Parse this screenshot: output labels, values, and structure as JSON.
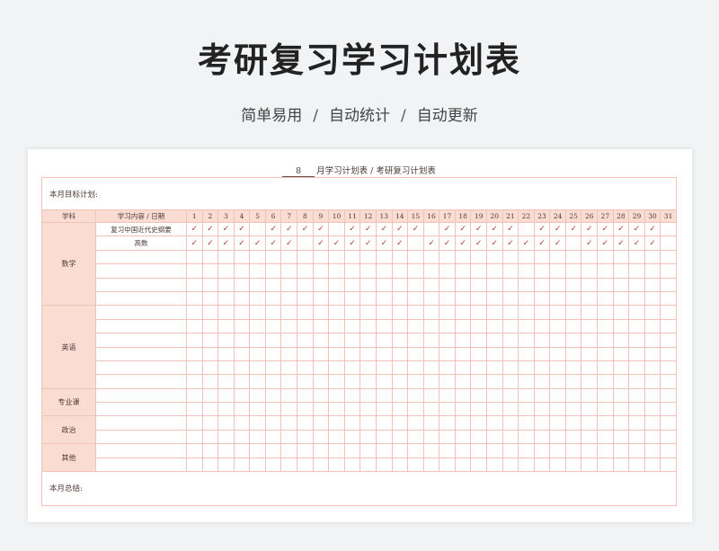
{
  "header": {
    "title": "考研复习学习计划表",
    "features": [
      "简单易用",
      "自动统计",
      "自动更新"
    ],
    "separator": "/"
  },
  "sheet": {
    "month": "8",
    "heading": "月学习计划表 / 考研复习计划表",
    "goal_label": "本月目标计划:",
    "summary_label": "本月总结:",
    "check_mark": "✓",
    "columns": {
      "subject": "学科",
      "content": "学习内容 / 日期",
      "days": [
        "1",
        "2",
        "3",
        "4",
        "5",
        "6",
        "7",
        "8",
        "9",
        "10",
        "11",
        "12",
        "13",
        "14",
        "15",
        "16",
        "17",
        "18",
        "19",
        "20",
        "21",
        "22",
        "23",
        "24",
        "25",
        "26",
        "27",
        "28",
        "29",
        "30",
        "31"
      ]
    },
    "subjects": [
      {
        "name": "数学",
        "rows": [
          {
            "content": "复习中国近代史纲要",
            "checked": [
              1,
              2,
              3,
              4,
              6,
              7,
              8,
              9,
              11,
              12,
              13,
              14,
              15,
              17,
              18,
              19,
              20,
              21,
              23,
              24,
              25,
              26,
              27,
              28,
              29,
              30
            ]
          },
          {
            "content": "高数",
            "checked": [
              1,
              2,
              3,
              4,
              5,
              6,
              7,
              9,
              10,
              11,
              12,
              13,
              14,
              16,
              17,
              18,
              19,
              20,
              21,
              22,
              23,
              24,
              26,
              27,
              28,
              29,
              30
            ]
          },
          {
            "content": "",
            "checked": []
          },
          {
            "content": "",
            "checked": []
          },
          {
            "content": "",
            "checked": []
          },
          {
            "content": "",
            "checked": []
          }
        ]
      },
      {
        "name": "英语",
        "rows": [
          {
            "content": "",
            "checked": []
          },
          {
            "content": "",
            "checked": []
          },
          {
            "content": "",
            "checked": []
          },
          {
            "content": "",
            "checked": []
          },
          {
            "content": "",
            "checked": []
          },
          {
            "content": "",
            "checked": []
          }
        ]
      },
      {
        "name": "专业课",
        "rows": [
          {
            "content": "",
            "checked": []
          },
          {
            "content": "",
            "checked": []
          }
        ]
      },
      {
        "name": "政治",
        "rows": [
          {
            "content": "",
            "checked": []
          },
          {
            "content": "",
            "checked": []
          }
        ]
      },
      {
        "name": "其他",
        "rows": [
          {
            "content": "",
            "checked": []
          },
          {
            "content": "",
            "checked": []
          }
        ]
      }
    ]
  }
}
